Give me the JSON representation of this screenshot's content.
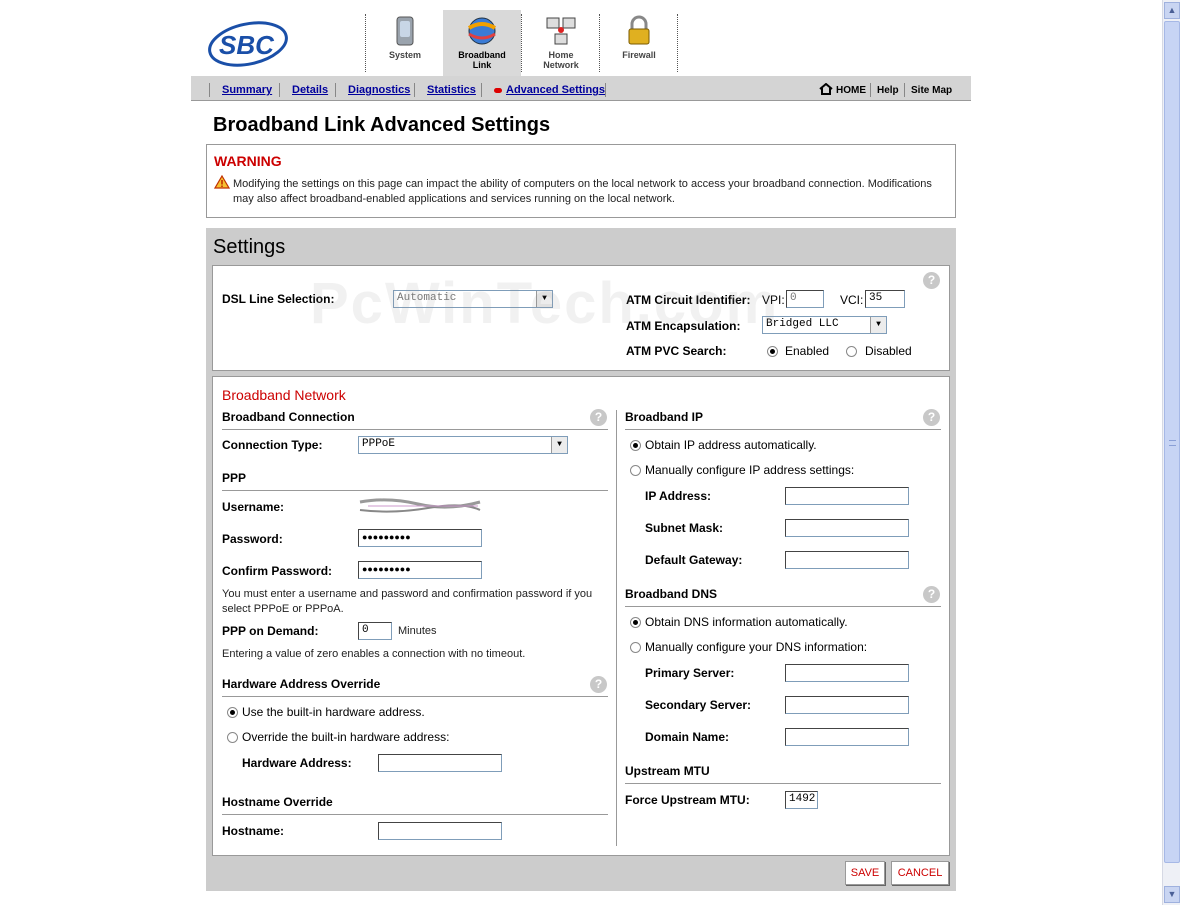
{
  "header": {
    "logo_text": "SBC",
    "nav": [
      {
        "label1": "System",
        "label2": ""
      },
      {
        "label1": "Broadband",
        "label2": "Link"
      },
      {
        "label1": "Home",
        "label2": "Network"
      },
      {
        "label1": "Firewall",
        "label2": ""
      }
    ]
  },
  "subnav": {
    "links": [
      "Summary",
      "Details",
      "Diagnostics",
      "Statistics",
      "Advanced Settings"
    ],
    "home": "HOME",
    "help": "Help",
    "sitemap": "Site Map"
  },
  "page_title": "Broadband Link Advanced Settings",
  "warning": {
    "title": "WARNING",
    "text": "Modifying the settings on this page can impact the ability of computers on the local network to access your broadband connection. Modifications may also affect broadband-enabled applications and services running on the local network."
  },
  "settings": {
    "title": "Settings",
    "dsl_line_label": "DSL Line Selection:",
    "dsl_line_value": "Automatic",
    "atm_circuit_label": "ATM Circuit Identifier:",
    "vpi_label": "VPI:",
    "vpi_value": "0",
    "vci_label": "VCI:",
    "vci_value": "35",
    "atm_encap_label": "ATM Encapsulation:",
    "atm_encap_value": "Bridged LLC",
    "atm_pvc_label": "ATM PVC Search:",
    "pvc_enabled": "Enabled",
    "pvc_disabled": "Disabled"
  },
  "broadband_network": {
    "title": "Broadband Network",
    "connection_section": "Broadband Connection",
    "connection_type_label": "Connection Type:",
    "connection_type_value": "PPPoE",
    "ppp_section": "PPP",
    "username_label": "Username:",
    "password_label": "Password:",
    "password_value": "●●●●●●●●●",
    "confirm_label": "Confirm Password:",
    "confirm_value": "●●●●●●●●●",
    "ppp_note": "You must enter a username and password and confirmation password if you select PPPoE or PPPoA.",
    "demand_label": "PPP on Demand:",
    "demand_value": "0",
    "demand_units": "Minutes",
    "demand_note": "Entering a value of zero enables a connection with no timeout.",
    "hw_section": "Hardware Address Override",
    "hw_builtin": "Use the built-in hardware address.",
    "hw_override": "Override the built-in hardware address:",
    "hw_address_label": "Hardware Address:",
    "hostname_section": "Hostname Override",
    "hostname_label": "Hostname:",
    "ip_section": "Broadband IP",
    "ip_auto": "Obtain IP address automatically.",
    "ip_manual": "Manually configure IP address settings:",
    "ip_address_label": "IP Address:",
    "subnet_label": "Subnet Mask:",
    "gateway_label": "Default Gateway:",
    "dns_section": "Broadband DNS",
    "dns_auto": "Obtain DNS information automatically.",
    "dns_manual": "Manually configure your DNS information:",
    "primary_label": "Primary Server:",
    "secondary_label": "Secondary Server:",
    "domain_label": "Domain Name:",
    "mtu_section": "Upstream MTU",
    "mtu_label": "Force Upstream MTU:",
    "mtu_value": "1492"
  },
  "buttons": {
    "save": "SAVE",
    "cancel": "CANCEL"
  },
  "watermark": "PcWinTech.com",
  "colors": {
    "link": "#00009c",
    "warning": "#cc0000",
    "panel": "#cccccc"
  }
}
